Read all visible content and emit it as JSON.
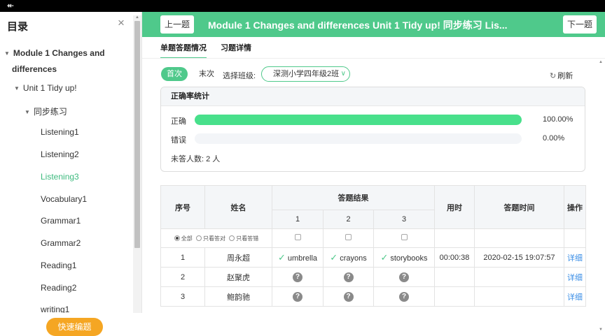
{
  "topbar": {
    "back_icon": "↞"
  },
  "sidebar": {
    "title": "目录",
    "close_icon": "×",
    "nodes": [
      {
        "label": "Module 1 Changes and",
        "label2": "differences"
      },
      {
        "label": "Unit 1 Tidy up!"
      },
      {
        "label": "同步练习"
      },
      {
        "label": "Listening1"
      },
      {
        "label": "Listening2"
      },
      {
        "label": "Listening3"
      },
      {
        "label": "Vocabulary1"
      },
      {
        "label": "Grammar1"
      },
      {
        "label": "Grammar2"
      },
      {
        "label": "Reading1"
      },
      {
        "label": "Reading2"
      },
      {
        "label": "writing1"
      }
    ],
    "quick_button": "快速编题"
  },
  "header": {
    "prev": "上一题",
    "title": "Module 1 Changes and differences Unit 1 Tidy up! 同步练习 Lis...",
    "next": "下一题",
    "color": "#4fc98b"
  },
  "tabs": [
    {
      "label": "单题答题情况"
    },
    {
      "label": "习题详情"
    }
  ],
  "filters": {
    "first": "首次",
    "last": "末次",
    "class_label": "选择班级:",
    "class_value": "深测小学四年级2班",
    "refresh": "刷新"
  },
  "stats": {
    "title": "正确率统计",
    "rows": [
      {
        "label": "正确",
        "percent_text": "100.00%",
        "fraction": 1.0
      },
      {
        "label": "错误",
        "percent_text": "0.00%",
        "fraction": 0.0
      }
    ],
    "unanswered": "未答人数: 2 人",
    "bar_color": "#48e08b"
  },
  "table": {
    "headers": {
      "index": "序号",
      "name": "姓名",
      "result": "答题结果",
      "time_used": "用时",
      "answer_time": "答题时间",
      "action": "操作"
    },
    "questions": [
      "1",
      "2",
      "3"
    ],
    "radio_filters": [
      "全部",
      "只看答对",
      "只看答错"
    ],
    "rows": [
      {
        "index": "1",
        "name": "周永超",
        "answers": [
          "umbrella",
          "crayons",
          "storybooks"
        ],
        "time_used": "00:00:38",
        "answer_time": "2020-02-15 19:07:57",
        "action": "详细"
      },
      {
        "index": "2",
        "name": "赵聚虎",
        "action": "详细"
      },
      {
        "index": "3",
        "name": "鲍韵驰",
        "action": "详细"
      }
    ]
  }
}
